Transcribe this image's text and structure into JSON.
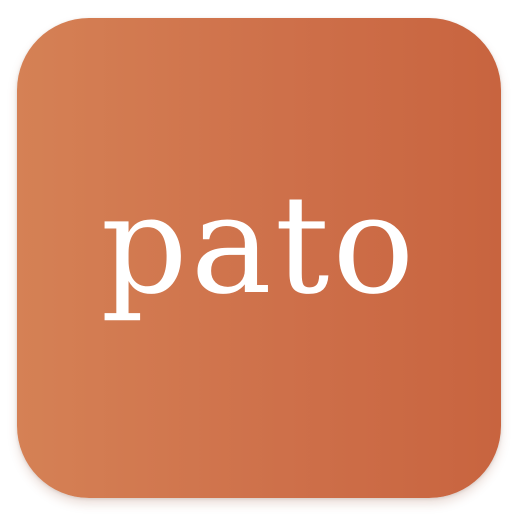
{
  "app_icon": {
    "wordmark": "pato",
    "colors": {
      "gradient_start": "#d58155",
      "gradient_end": "#c8643f",
      "text": "#ffffff"
    }
  }
}
